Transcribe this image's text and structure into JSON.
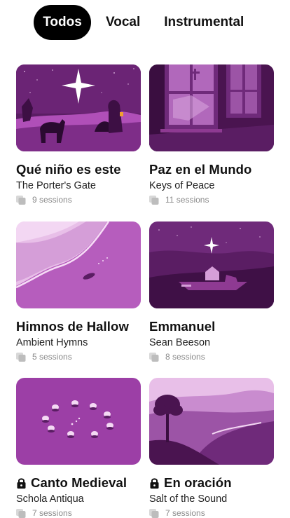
{
  "filters": {
    "tabs": [
      {
        "label": "Todos",
        "active": true
      },
      {
        "label": "Vocal",
        "active": false
      },
      {
        "label": "Instrumental",
        "active": false
      }
    ]
  },
  "colors": {
    "accent": "#8e3a92",
    "dark": "#4a1450",
    "light": "#e2b5e2",
    "active_tab_bg": "#000000"
  },
  "cards": [
    {
      "title": "Qué niño es este",
      "artist": "The Porter's Gate",
      "sessions": "9 sessions",
      "locked": false,
      "icon": "session-stack-icon"
    },
    {
      "title": "Paz en el Mundo",
      "artist": "Keys of Peace",
      "sessions": "11 sessions",
      "locked": false,
      "icon": "session-stack-icon"
    },
    {
      "title": "Himnos de Hallow",
      "artist": "Ambient Hymns",
      "sessions": "5 sessions",
      "locked": false,
      "icon": "session-stack-icon"
    },
    {
      "title": "Emmanuel",
      "artist": "Sean Beeson",
      "sessions": "8 sessions",
      "locked": false,
      "icon": "session-stack-icon"
    },
    {
      "title": "Canto Medieval",
      "artist": "Schola Antiqua",
      "sessions": "7 sessions",
      "locked": true,
      "icon": "lock-icon"
    },
    {
      "title": "En oración",
      "artist": "Salt of the Sound",
      "sessions": "7 sessions",
      "locked": true,
      "icon": "lock-icon"
    }
  ]
}
